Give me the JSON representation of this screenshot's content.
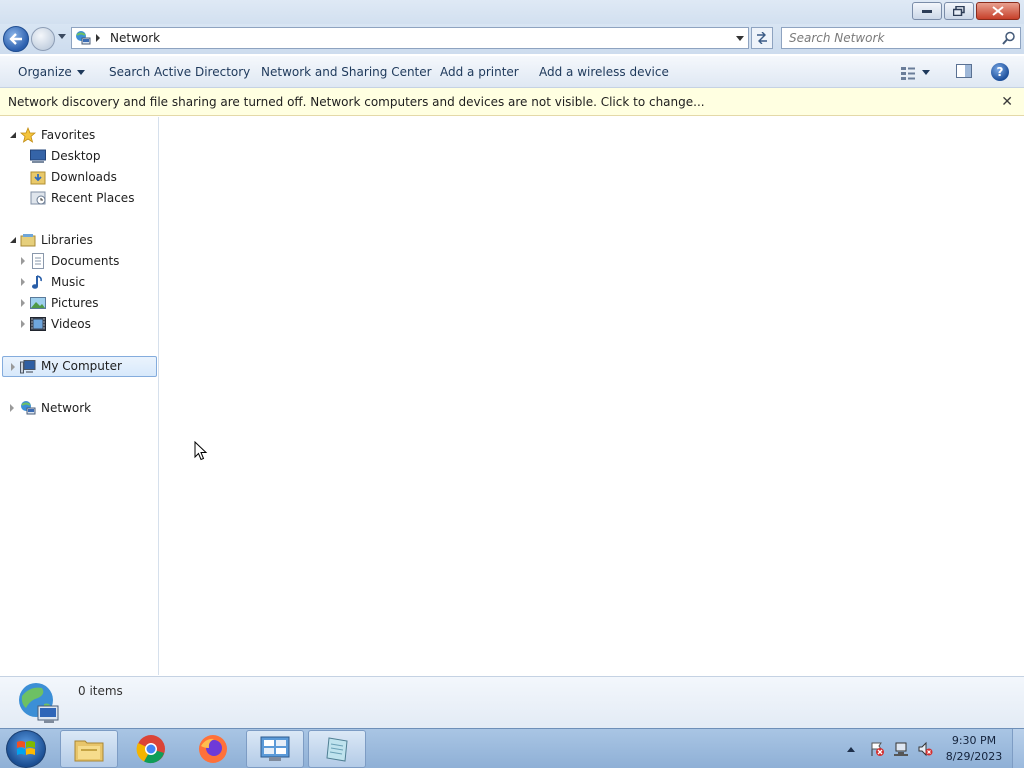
{
  "window": {
    "address": {
      "crumb": "Network"
    },
    "search": {
      "placeholder": "Search Network"
    }
  },
  "toolbar": {
    "organize": "Organize",
    "search_ad": "Search Active Directory",
    "network_sharing": "Network and Sharing Center",
    "add_printer": "Add a printer",
    "add_wireless": "Add a wireless device"
  },
  "infobar": {
    "message": "Network discovery and file sharing are turned off. Network computers and devices are not visible. Click to change..."
  },
  "nav": {
    "favorites": "Favorites",
    "desktop": "Desktop",
    "downloads": "Downloads",
    "recent_places": "Recent Places",
    "libraries": "Libraries",
    "documents": "Documents",
    "music": "Music",
    "pictures": "Pictures",
    "videos": "Videos",
    "my_computer": "My Computer",
    "network": "Network"
  },
  "details": {
    "count": "0 items"
  },
  "taskbar": {
    "apps": [
      "file-explorer",
      "chrome",
      "firefox",
      "control-panel",
      "notepad"
    ],
    "active_app": "file-explorer"
  },
  "clock": {
    "time": "9:30 PM",
    "date": "8/29/2023"
  },
  "colors": {
    "infobar_bg": "#ffffe1",
    "selection": "#d8e9fb",
    "taskbar": "#9ab9dd"
  }
}
